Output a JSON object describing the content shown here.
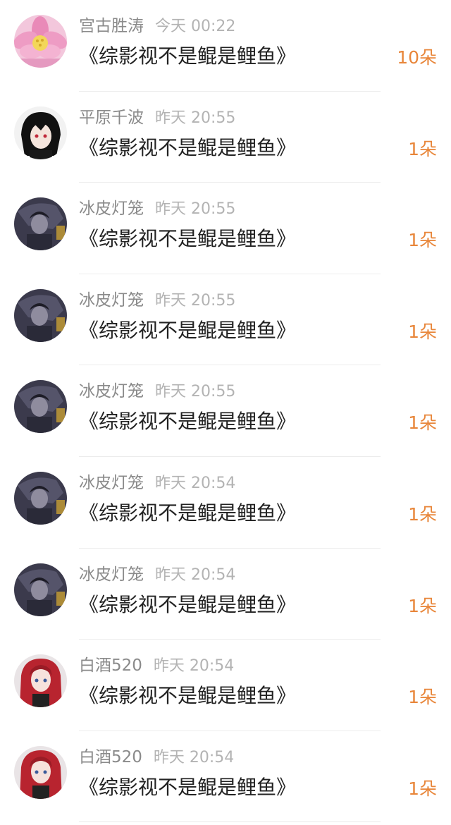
{
  "gift_list": {
    "rows": [
      {
        "name": "宫古胜涛",
        "time": "今天 00:22",
        "book": "《综影视不是鲲是鲤鱼》",
        "count": "10朵",
        "avatar": "pink-lotus-flower"
      },
      {
        "name": "平原千波",
        "time": "昨天 20:55",
        "book": "《综影视不是鲲是鲤鱼》",
        "count": "1朵",
        "avatar": "anime-boy-dark-hair"
      },
      {
        "name": "冰皮灯笼",
        "time": "昨天 20:55",
        "book": "《综影视不是鲲是鲤鱼》",
        "count": "1朵",
        "avatar": "anime-dark-character"
      },
      {
        "name": "冰皮灯笼",
        "time": "昨天 20:55",
        "book": "《综影视不是鲲是鲤鱼》",
        "count": "1朵",
        "avatar": "anime-dark-character"
      },
      {
        "name": "冰皮灯笼",
        "time": "昨天 20:55",
        "book": "《综影视不是鲲是鲤鱼》",
        "count": "1朵",
        "avatar": "anime-dark-character"
      },
      {
        "name": "冰皮灯笼",
        "time": "昨天 20:54",
        "book": "《综影视不是鲲是鲤鱼》",
        "count": "1朵",
        "avatar": "anime-dark-character"
      },
      {
        "name": "冰皮灯笼",
        "time": "昨天 20:54",
        "book": "《综影视不是鲲是鲤鱼》",
        "count": "1朵",
        "avatar": "anime-dark-character"
      },
      {
        "name": "白酒520",
        "time": "昨天 20:54",
        "book": "《综影视不是鲲是鲤鱼》",
        "count": "1朵",
        "avatar": "anime-red-hair-girl"
      },
      {
        "name": "白酒520",
        "time": "昨天 20:54",
        "book": "《综影视不是鲲是鲤鱼》",
        "count": "1朵",
        "avatar": "anime-red-hair-girl"
      }
    ]
  },
  "colors": {
    "name": "#8a8a8a",
    "time": "#b3b3b3",
    "book": "#222222",
    "count": "#e8863a",
    "divider": "#ececec"
  }
}
